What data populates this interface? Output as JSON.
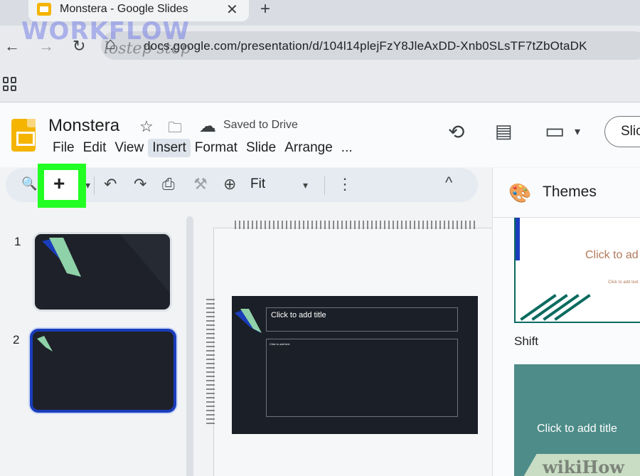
{
  "browser": {
    "tab_title": "Monstera - Google Slides",
    "close_glyph": "✕",
    "new_tab_glyph": "+",
    "url": "docs.google.com/presentation/d/104l14plejFzY8JleAxDD-Xnb0SLsTF7tZbOtaDK",
    "nav": {
      "back": "←",
      "forward": "→",
      "reload": "↻",
      "home": "⌂"
    }
  },
  "watermark": {
    "brand": "WORKFLOW",
    "sub": "lostep step"
  },
  "app": {
    "doc_title": "Monstera",
    "star_glyph": "☆",
    "move_glyph": "🗀",
    "cloud_glyph": "☁",
    "saved_status": "Saved to Drive",
    "menu": [
      "File",
      "Edit",
      "View",
      "Insert",
      "Format",
      "Slide",
      "Arrange",
      "..."
    ],
    "active_menu_index": 3,
    "history_glyph": "⟲",
    "comment_glyph": "▤",
    "meet_glyph": "▭",
    "meet_caret": "▾",
    "present_label": "Slic"
  },
  "toolbar": {
    "search_glyph": "🔍",
    "new_slide_glyph": "+",
    "new_slide_caret": "▾",
    "undo_glyph": "↶",
    "redo_glyph": "↷",
    "print_glyph": "⎙",
    "paint_glyph": "⚒",
    "zoom_glyph": "⊕",
    "zoom_value": "Fit",
    "zoom_caret": "▾",
    "more_glyph": "⋮",
    "collapse_glyph": "^"
  },
  "filmstrip": {
    "slides": [
      {
        "number": "1"
      },
      {
        "number": "2"
      }
    ],
    "selected_index": 1
  },
  "canvas": {
    "title_placeholder": "Click to add title",
    "body_placeholder": "Click to add text"
  },
  "themes": {
    "palette_glyph": "🎨",
    "title": "Themes",
    "card1_title": "Click to ad",
    "card1_sub": "Click to add text",
    "card2_label": "Shift",
    "card2_title": "Click to add title",
    "card2_watermark": "wikiHow"
  },
  "colors": {
    "highlight": "#22ff22",
    "slide_bg": "#1b1f27",
    "accent_blue": "#1a3dbb",
    "accent_green": "#8fd1a8",
    "slides_yellow": "#f4b400"
  }
}
